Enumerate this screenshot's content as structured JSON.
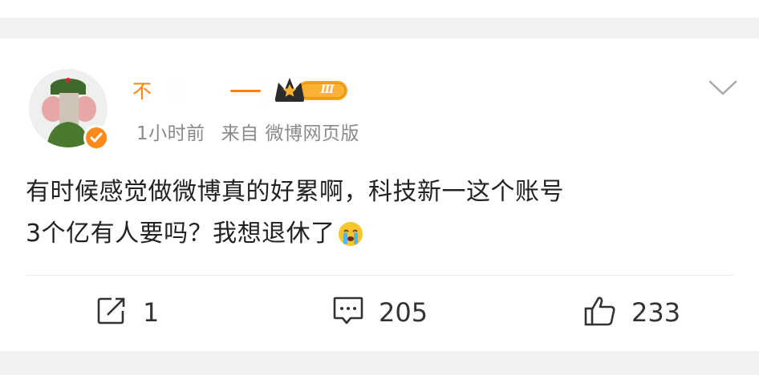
{
  "post": {
    "author": {
      "name_visible_start": "不",
      "member_level": "Ⅲ"
    },
    "meta": {
      "time": "1小时前",
      "source": "来自 微博网页版"
    },
    "content": {
      "line1": "有时候感觉做微博真的好累啊，科技新一这个账号",
      "line2": "3个亿有人要吗？我想退休了",
      "emoji": "crying-face"
    },
    "actions": {
      "repost_count": "1",
      "comment_count": "205",
      "like_count": "233"
    }
  },
  "colors": {
    "username": "#ff8200",
    "meta": "#8a8a8a",
    "text": "#222222",
    "separator_bg": "#f2f2f2"
  }
}
